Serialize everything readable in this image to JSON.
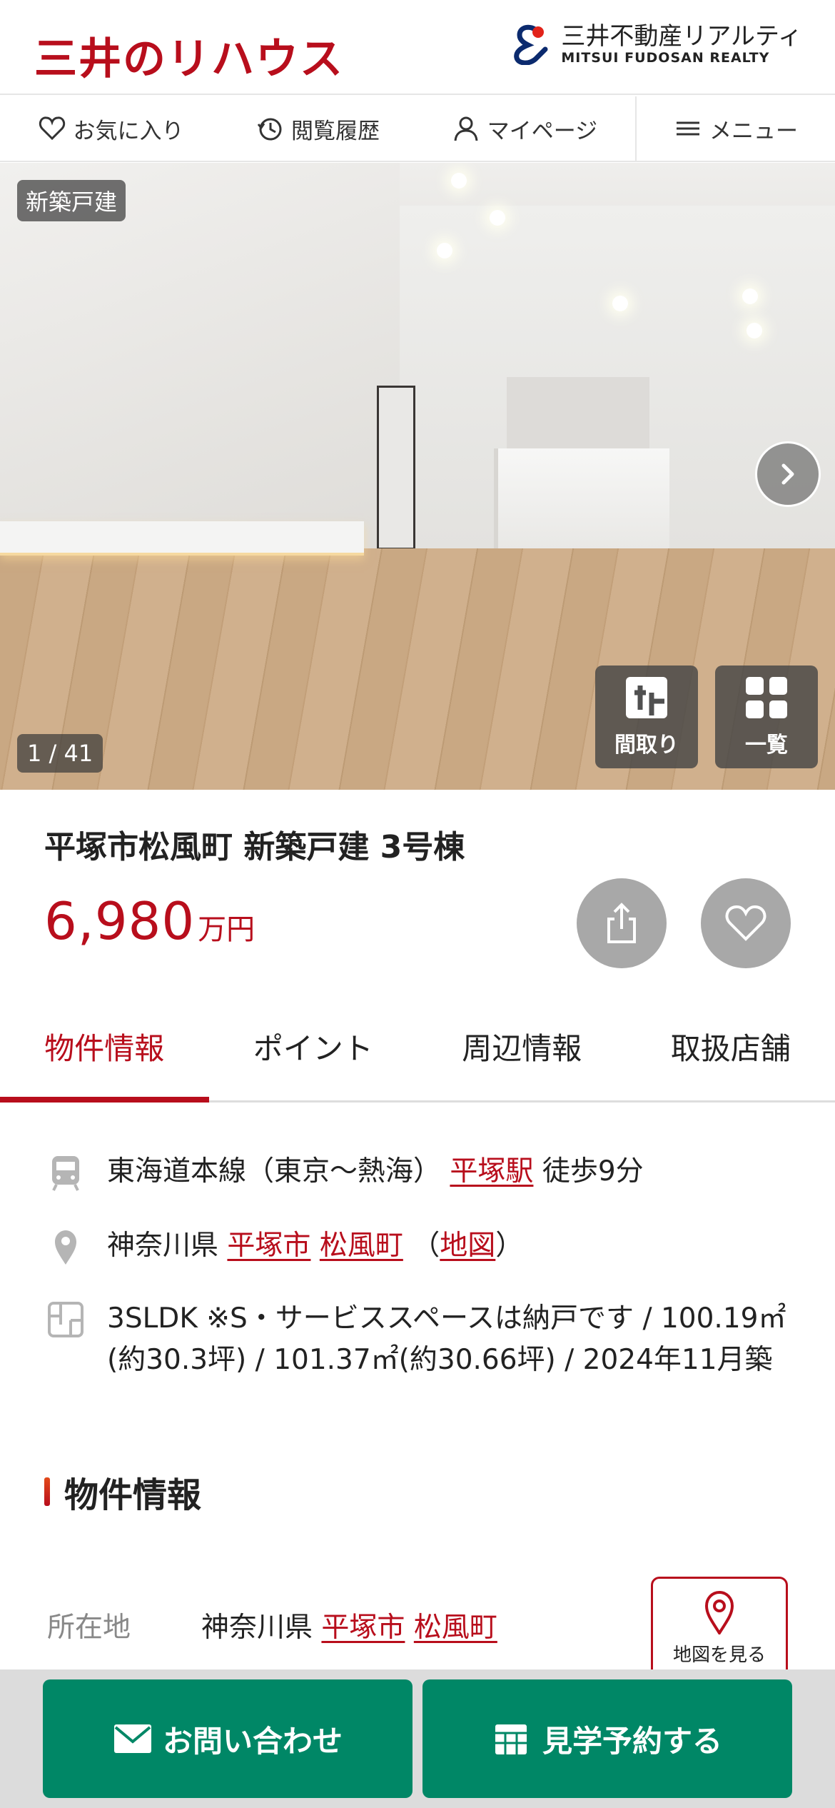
{
  "header": {
    "brand": "三井のリハウス",
    "realty_ja": "三井不動産リアルティ",
    "realty_en": "MITSUI FUDOSAN REALTY"
  },
  "nav": {
    "favorites": "お気に入り",
    "history": "閲覧履歴",
    "mypage": "マイページ",
    "menu": "メニュー"
  },
  "gallery": {
    "tag": "新築戸建",
    "counter": "1 / 41",
    "floorplan_label": "間取り",
    "list_label": "一覧"
  },
  "property": {
    "title": "平塚市松風町 新築戸建 3号棟",
    "price": "6,980",
    "price_unit": "万円"
  },
  "tabs": [
    "物件情報",
    "ポイント",
    "周辺情報",
    "取扱店舗"
  ],
  "summary": {
    "line": "東海道本線（東京〜熱海）",
    "station": "平塚駅",
    "walk": "徒歩9分",
    "prefecture": "神奈川県",
    "city": "平塚市",
    "town": "松風町",
    "map_open": "（",
    "map_link": "地図",
    "map_close": "）",
    "layout": "3SLDK ※S・サービススペースは納戸です / 100.19㎡(約30.3坪) / 101.37㎡(約30.66坪) / 2024年11月築"
  },
  "section": {
    "heading": "物件情報",
    "location_label": "所在地",
    "location_pref": "神奈川県",
    "location_city": "平塚市",
    "location_town": "松風町",
    "map_button": "地図を見る"
  },
  "cta": {
    "contact": "お問い合わせ",
    "visit": "見学予約する"
  },
  "colors": {
    "brand_red": "#b80e1c",
    "cta_green": "#008766"
  }
}
